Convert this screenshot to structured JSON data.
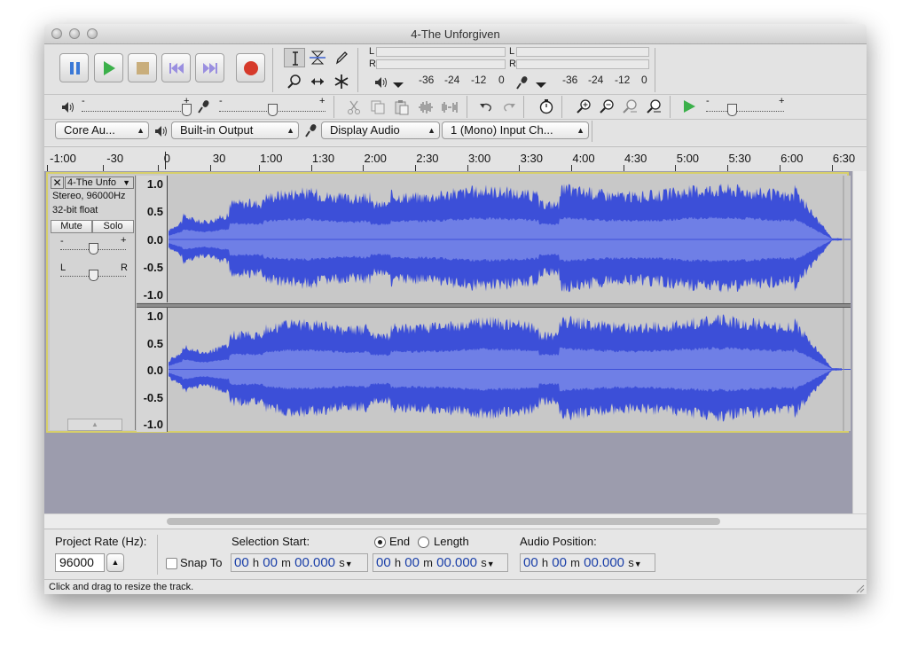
{
  "window": {
    "title": "4-The Unforgiven"
  },
  "transport": {
    "buttons": [
      "pause",
      "play",
      "stop",
      "skip-to-start",
      "skip-to-end",
      "record"
    ]
  },
  "meters": {
    "play_left": "L",
    "play_right": "R",
    "rec_left": "L",
    "rec_right": "R",
    "scale": [
      "-36",
      "-24",
      "-12",
      "0"
    ]
  },
  "mixer": {
    "output_volume_label": "-",
    "output_volume_plus": "+",
    "input_volume_minus": "-",
    "input_volume_plus": "+",
    "speed_minus": "-",
    "speed_plus": "+"
  },
  "device": {
    "host": "Core Au...",
    "output": "Built-in Output",
    "input": "Display Audio",
    "channels": "1 (Mono) Input Ch..."
  },
  "timeline": {
    "labels": [
      "-1:00",
      "-30",
      "0",
      "30",
      "1:00",
      "1:30",
      "2:00",
      "2:30",
      "3:00",
      "3:30",
      "4:00",
      "4:30",
      "5:00",
      "5:30",
      "6:00",
      "6:30"
    ]
  },
  "track": {
    "name": "4-The Unfo",
    "info_format": "Stereo, 96000Hz",
    "info_bits": "32-bit float",
    "mute": "Mute",
    "solo": "Solo",
    "gain_minus": "-",
    "gain_plus": "+",
    "pan_left": "L",
    "pan_right": "R",
    "amplitude_labels": [
      "1.0",
      "0.5",
      "0.0",
      "-0.5",
      "-1.0"
    ]
  },
  "selection_toolbar": {
    "project_rate_label": "Project Rate (Hz):",
    "project_rate_value": "96000",
    "snap_to_label": "Snap To",
    "selection_start_label": "Selection Start:",
    "end_label": "End",
    "length_label": "Length",
    "audio_position_label": "Audio Position:",
    "time_hours": "00",
    "time_h": "h",
    "time_minutes": "00",
    "time_m": "m",
    "time_seconds": "00.000",
    "time_s": "s"
  },
  "status": {
    "text": "Click and drag to resize the track."
  },
  "colors": {
    "waveform": "#3c4fd8",
    "waveform_rms": "#6f7fe6",
    "track_bg": "#c8c8c8",
    "selected_border": "#d7cf6a",
    "window_bg": "#e8e8e8"
  }
}
